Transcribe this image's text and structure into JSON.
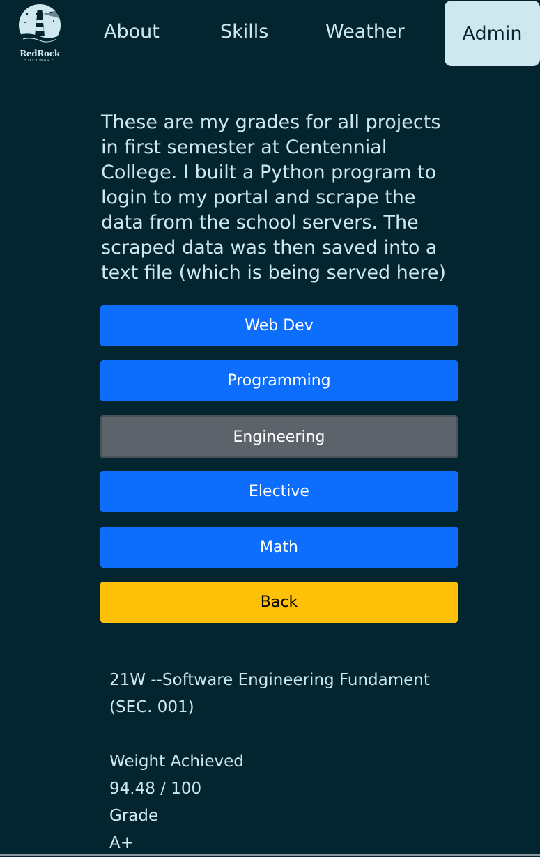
{
  "brand": {
    "name": "RedRock",
    "sub": "SOFTWARE"
  },
  "nav": {
    "about": "About",
    "skills": "Skills",
    "weather": "Weather",
    "admin": "Admin"
  },
  "intro": "These are my grades for all projects in first semester at Centennial College. I built a Python program to login to my portal and scrape the data from the school servers. The scraped data was then saved into a text file (which is being served here)",
  "buttons": {
    "web_dev": "Web Dev",
    "programming": "Programming",
    "engineering": "Engineering",
    "elective": "Elective",
    "math": "Math",
    "back": "Back"
  },
  "course": {
    "title": "21W --Software Engineering Fundament",
    "section": "(SEC. 001)",
    "weight_label": "Weight Achieved",
    "weight_value": "94.48 / 100",
    "grade_label": "Grade",
    "grade_value": "A+"
  },
  "colors": {
    "background": "#032530",
    "text": "#cfe7ee",
    "primary": "#0d6efd",
    "secondary": "#5c636a",
    "warning": "#ffc107"
  }
}
